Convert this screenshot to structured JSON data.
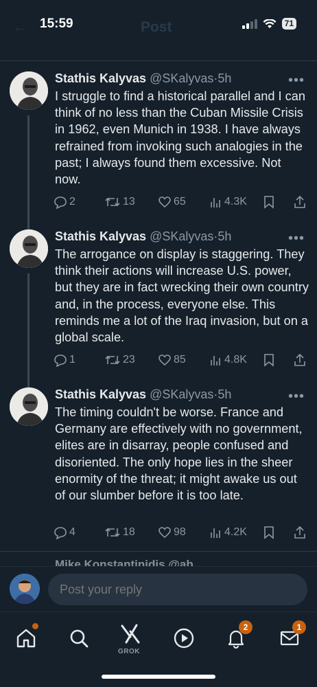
{
  "status_bar": {
    "time": "15:59",
    "battery": "71"
  },
  "header": {
    "title": "Post"
  },
  "tweets": [
    {
      "name": "Stathis Kalyvas",
      "handle": "@SKalyvas",
      "sep": "·",
      "time": "5h",
      "text": "I struggle to find a historical parallel and I can think of no less than the Cuban Missile Crisis in 1962, even Munich in 1938. I have always refrained from invoking such analogies in the past; I always found them excessive. Not now.",
      "replies": "2",
      "reposts": "13",
      "likes": "65",
      "views": "4.3K"
    },
    {
      "name": "Stathis Kalyvas",
      "handle": "@SKalyvas",
      "sep": "·",
      "time": "5h",
      "text": "The arrogance on display is staggering. They think their actions will increase U.S. power, but they are in fact wrecking their own country and, in the process, everyone else. This reminds me a lot of the Iraq invasion,  but on a global scale.",
      "replies": "1",
      "reposts": "23",
      "likes": "85",
      "views": "4.8K"
    },
    {
      "name": "Stathis Kalyvas",
      "handle": "@SKalyvas",
      "sep": "·",
      "time": "5h",
      "text": "The timing couldn't be worse.  France and Germany are effectively with no government, elites are in disarray, people confused and disoriented. The only hope lies in the sheer enormity of the threat; it might awake us out of our slumber before it is too late.",
      "replies": "4",
      "reposts": "18",
      "likes": "98",
      "views": "4.2K"
    }
  ],
  "peek": {
    "text": "Mike Konstantinidis @ab..."
  },
  "reply": {
    "placeholder": "Post your reply"
  },
  "tabbar": {
    "grok_label": "GROK",
    "notifications_badge": "2",
    "messages_badge": "1",
    "badge_color": "#c9620f"
  },
  "colors": {
    "background": "#15202b",
    "text": "#e7e9ea",
    "secondary": "#8b98a5"
  }
}
